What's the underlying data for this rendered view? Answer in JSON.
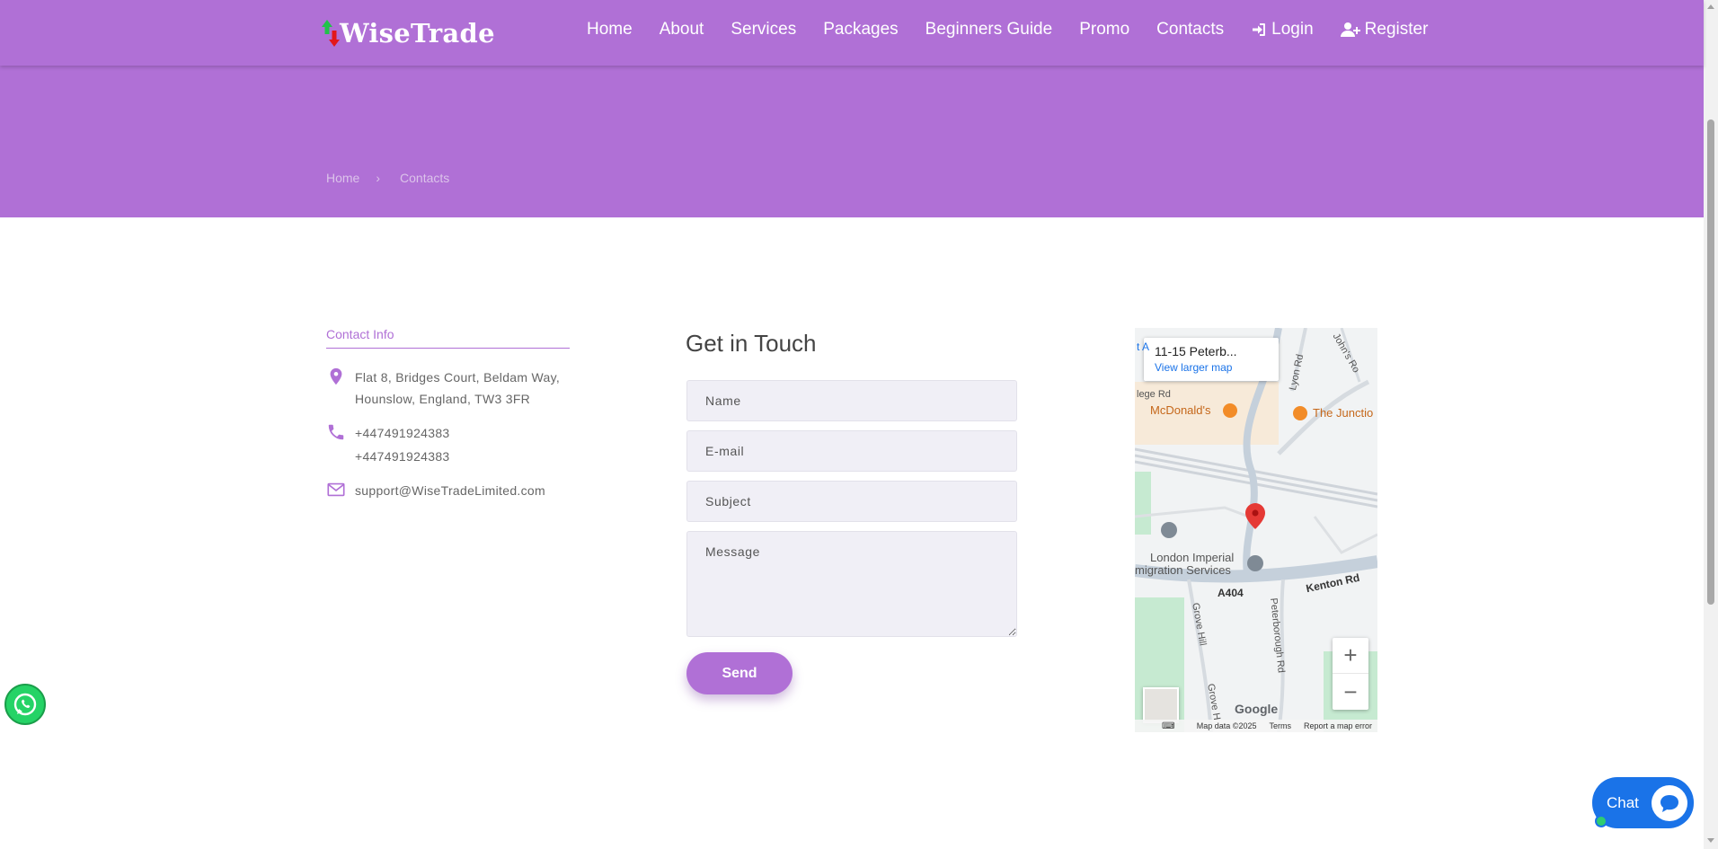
{
  "brand": {
    "name": "WiseTrade"
  },
  "nav": {
    "items": [
      {
        "label": "Home"
      },
      {
        "label": "About"
      },
      {
        "label": "Services"
      },
      {
        "label": "Packages"
      },
      {
        "label": "Beginners Guide"
      },
      {
        "label": "Promo"
      },
      {
        "label": "Contacts"
      },
      {
        "label": "Login",
        "icon": "login-icon"
      },
      {
        "label": "Register",
        "icon": "user-plus-icon"
      }
    ]
  },
  "breadcrumb": {
    "home": "Home",
    "separator": "›",
    "current": "Contacts"
  },
  "contact_info": {
    "title": "Contact Info",
    "address_line1": "Flat 8, Bridges Court, Beldam Way,",
    "address_line2": "Hounslow, England, TW3 3FR",
    "phone1": "+447491924383",
    "phone2": "+447491924383",
    "email": "support@WiseTradeLimited.com"
  },
  "form": {
    "title": "Get in Touch",
    "name_placeholder": "Name",
    "email_placeholder": "E-mail",
    "subject_placeholder": "Subject",
    "message_placeholder": "Message",
    "send_label": "Send"
  },
  "map": {
    "card_title": "11-15 Peterb...",
    "card_link": "View larger map",
    "labels": {
      "mcdonalds": "McDonald's",
      "junction": "The Junctio",
      "london_imperial_1": "London Imperial",
      "london_imperial_2": "migration Services",
      "a404": "A404",
      "kenton": "Kenton Rd",
      "lyon": "Lyon Rd",
      "johns": "John's Ro",
      "grove_hill": "Grove Hill",
      "peterborough": "Peterborough Rd",
      "grove_h": "Grove H",
      "ege": "lege Rd",
      "edge_t": "t A"
    },
    "zoom_in": "+",
    "zoom_out": "−",
    "google": "Google",
    "map_data": "Map data ©2025",
    "terms": "Terms",
    "report": "Report a map error"
  },
  "chat": {
    "label": "Chat"
  },
  "colors": {
    "primary": "#b070d6",
    "chat": "#1a73e8",
    "whatsapp": "#25d366"
  }
}
